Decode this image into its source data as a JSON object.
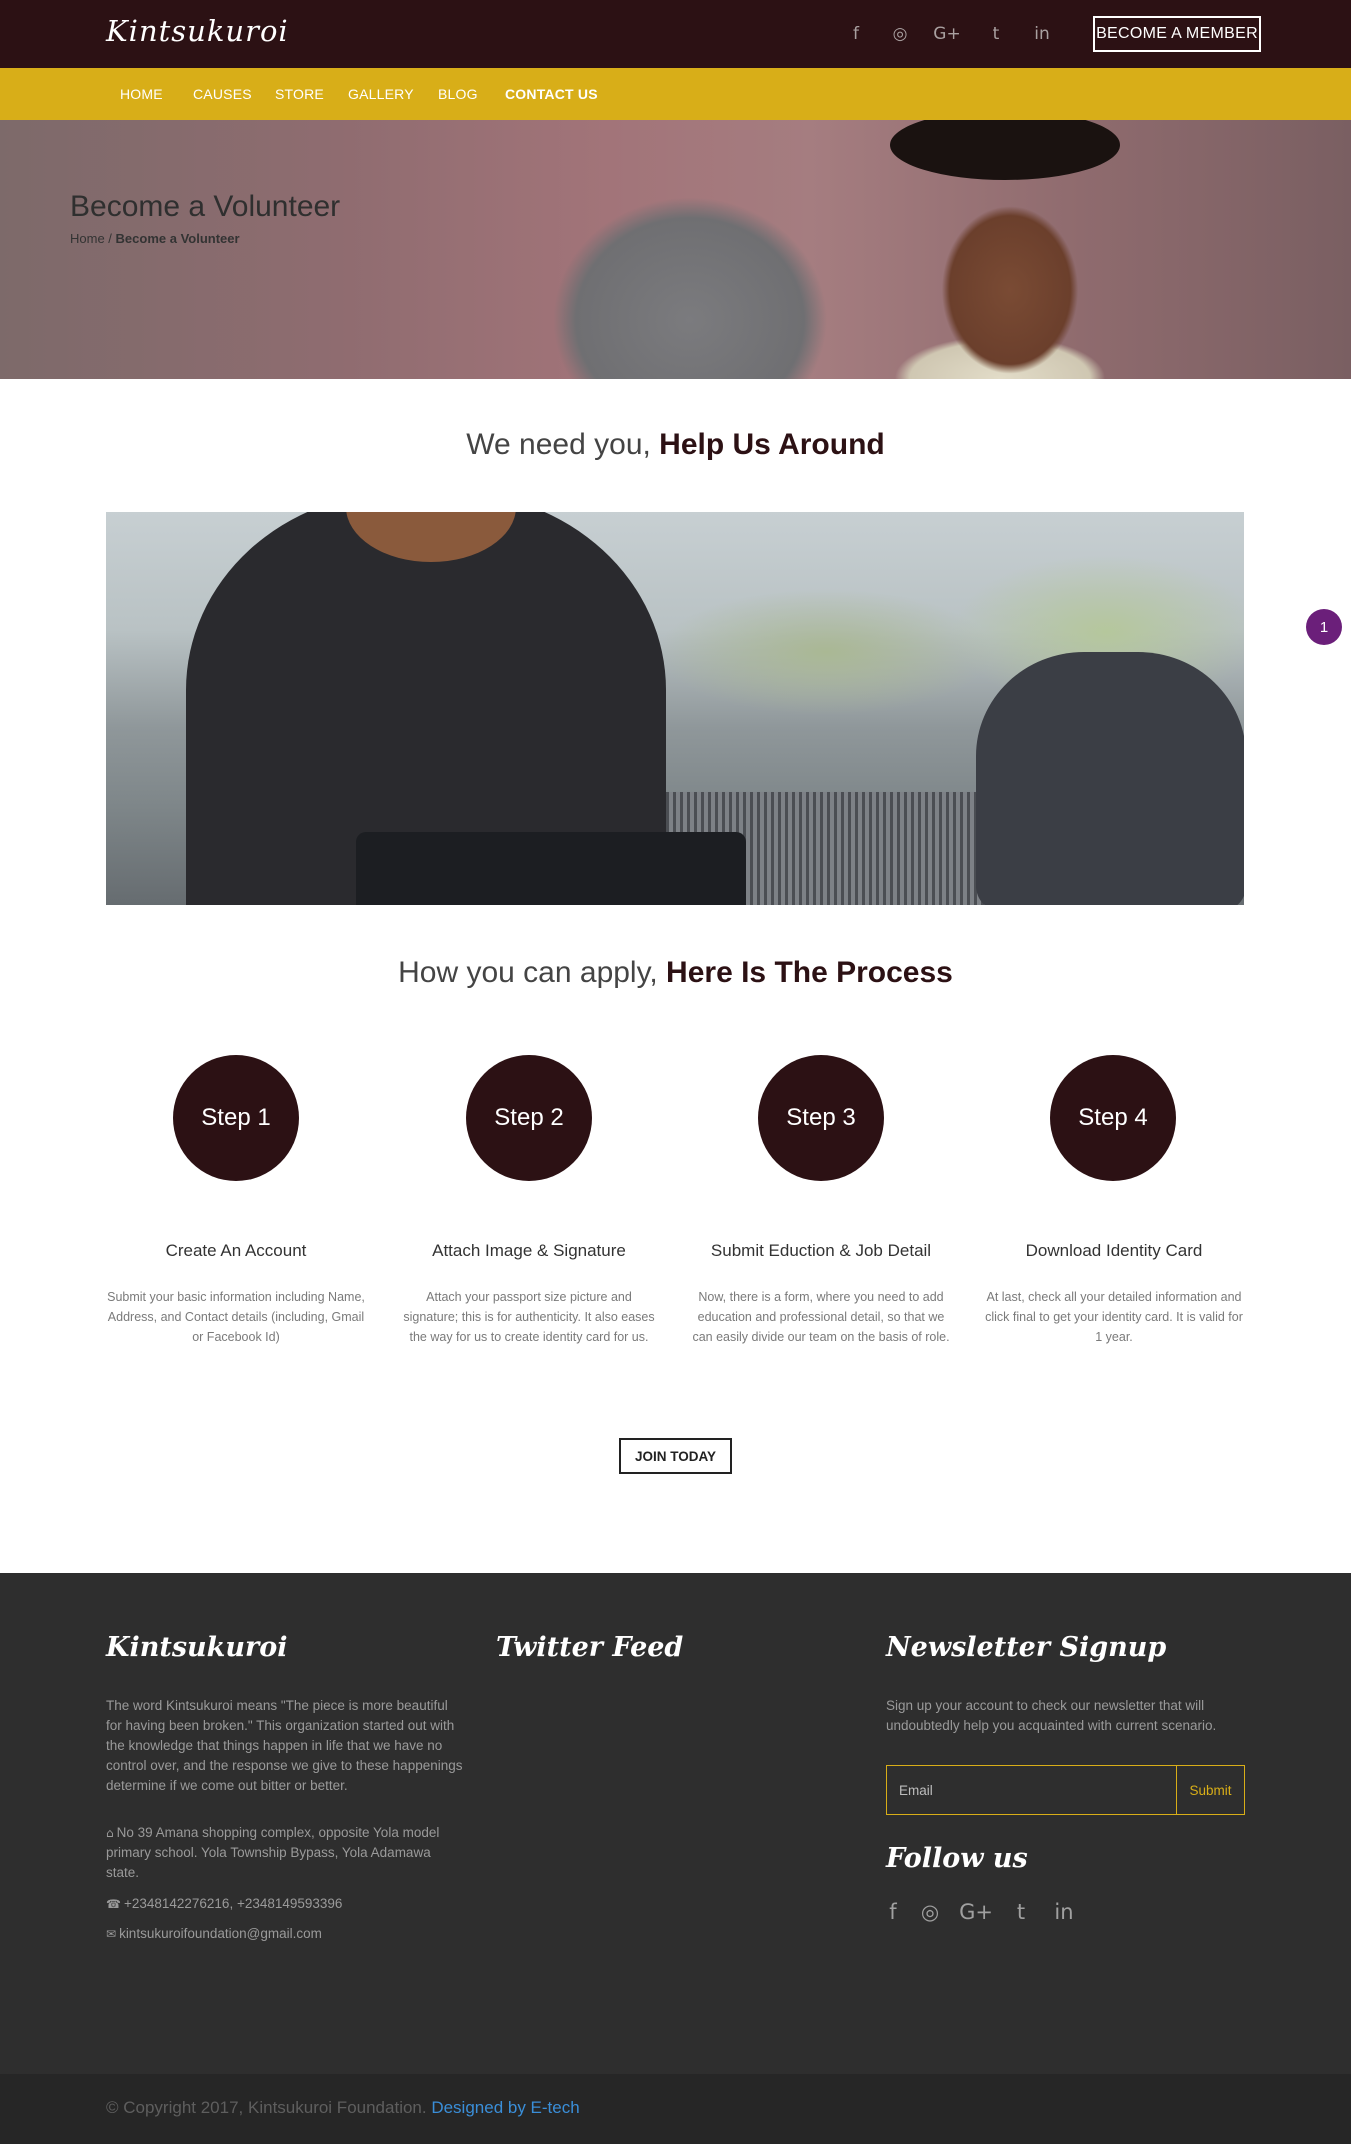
{
  "header": {
    "logo": "Kintsukuroi",
    "social_icons": [
      "facebook-icon",
      "instagram-icon",
      "google-plus-icon",
      "twitter-icon",
      "linkedin-icon"
    ],
    "social_glyphs": [
      "f",
      "◎",
      "G+",
      "t",
      "in"
    ],
    "member_button": "BECOME A MEMBER"
  },
  "nav": {
    "items": [
      "HOME",
      "CAUSES",
      "STORE",
      "GALLERY",
      "BLOG",
      "CONTACT US"
    ],
    "active": "CONTACT US"
  },
  "hero": {
    "title": "Become a Volunteer",
    "breadcrumb_home": "Home",
    "breadcrumb_sep": " / ",
    "breadcrumb_current": "Become a Volunteer"
  },
  "intro": {
    "heading_light": "We need you, ",
    "heading_bold": "Help Us Around"
  },
  "process": {
    "heading_light": "How you can apply, ",
    "heading_bold": "Here Is The Process",
    "steps": [
      {
        "label": "Step 1",
        "title": "Create An Account",
        "desc": "Submit your basic information including Name, Address, and Contact details (including, Gmail or Facebook Id)"
      },
      {
        "label": "Step 2",
        "title": "Attach Image & Signature",
        "desc": "Attach your passport size picture and signature; this is for authenticity. It also eases the way for us to create identity card for us."
      },
      {
        "label": "Step 3",
        "title": "Submit Eduction & Job Detail",
        "desc": "Now, there is a form, where you need to add education and professional detail, so that we can easily divide our team on the basis of role."
      },
      {
        "label": "Step 4",
        "title": "Download Identity Card",
        "desc": "At last, check all your detailed information and click final to get your identity card. It is valid for 1 year."
      }
    ],
    "join_button": "JOIN TODAY"
  },
  "side_badge": "1",
  "footer": {
    "about": {
      "heading": "Kintsukuroi",
      "text": "The word Kintsukuroi means \"The piece is more beautiful for having been broken.\" This organization started out with the knowledge that things happen in life that we have no control over, and the response we give to these happenings determine if we come out bitter or better.",
      "address": "No 39 Amana shopping complex, opposite Yola model primary school. Yola Township Bypass, Yola Adamawa state.",
      "phone": "+2348142276216, +2348149593396",
      "email": "kintsukuroifoundation@gmail.com"
    },
    "twitter": {
      "heading": "Twitter Feed"
    },
    "newsletter": {
      "heading": "Newsletter Signup",
      "text": "Sign up your account to check our newsletter that will undoubtedly help you acquainted with current scenario.",
      "email_placeholder": "Email",
      "submit_label": "Submit",
      "follow_heading": "Follow us",
      "social_icons": [
        "facebook-icon",
        "instagram-icon",
        "google-plus-icon",
        "twitter-icon",
        "linkedin-icon"
      ],
      "social_glyphs": [
        "f",
        "◎",
        "G+",
        "t",
        "in"
      ]
    },
    "copyright": "© Copyright 2017, Kintsukuroi Foundation. ",
    "designer": "Designed by E-tech"
  },
  "colors": {
    "header_bg": "#2c1114",
    "nav_bg": "#d8ae18",
    "step_circle": "#2c1114",
    "footer_bg": "#2e2e2e",
    "link": "#3a8ed8",
    "badge": "#6b1f7a"
  }
}
